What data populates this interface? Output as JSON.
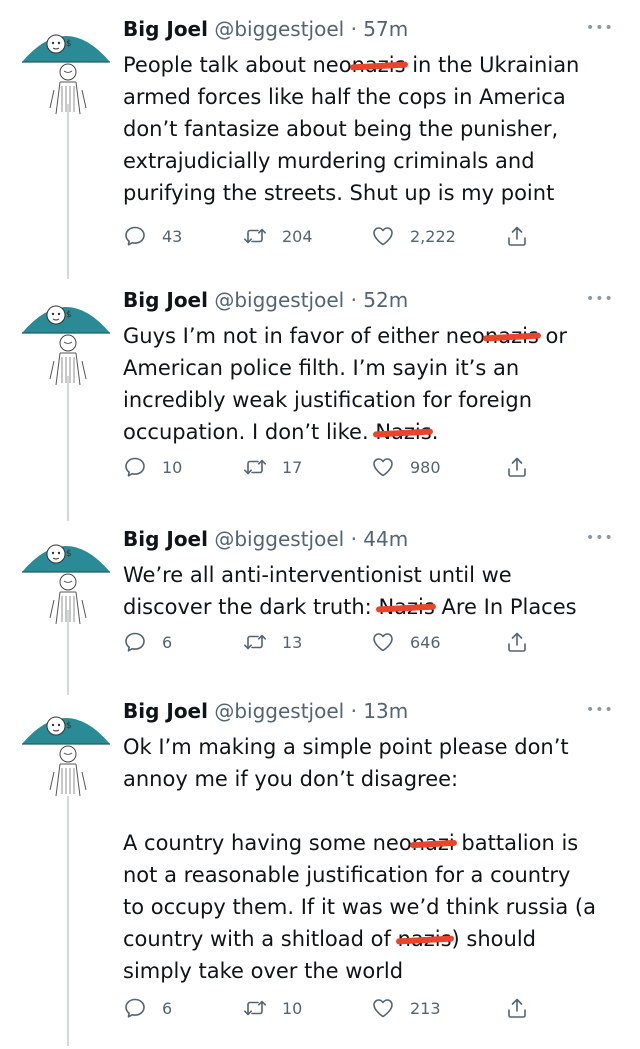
{
  "tweets": [
    {
      "name": "Big Joel",
      "handle": "@biggestjoel",
      "time": "57m",
      "lines": [
        [
          {
            "t": "People talk about neo"
          },
          {
            "t": "nazis",
            "r": true
          },
          {
            "t": " in the Ukrainian"
          }
        ],
        [
          {
            "t": "armed forces like half the cops in America"
          }
        ],
        [
          {
            "t": "don’t fantasize about being the punisher,"
          }
        ],
        [
          {
            "t": "extrajudicially murdering criminals and"
          }
        ],
        [
          {
            "t": "purifying the streets. Shut up is my point"
          }
        ]
      ],
      "replies": "43",
      "retweets": "204",
      "likes": "2,222"
    },
    {
      "name": "Big Joel",
      "handle": "@biggestjoel",
      "time": "52m",
      "lines": [
        [
          {
            "t": "Guys I’m not in favor of either neo"
          },
          {
            "t": "nazis",
            "r": true
          },
          {
            "t": " or"
          }
        ],
        [
          {
            "t": "American police filth. I’m sayin it’s an"
          }
        ],
        [
          {
            "t": "incredibly weak justification for foreign"
          }
        ],
        [
          {
            "t": "occupation. I don’t like. "
          },
          {
            "t": "Nazis",
            "r": true
          },
          {
            "t": "."
          }
        ]
      ],
      "replies": "10",
      "retweets": "17",
      "likes": "980"
    },
    {
      "name": "Big Joel",
      "handle": "@biggestjoel",
      "time": "44m",
      "lines": [
        [
          {
            "t": "We’re all anti-interventionist until we"
          }
        ],
        [
          {
            "t": "discover the dark truth: "
          },
          {
            "t": "Nazis",
            "r": true
          },
          {
            "t": " Are In Places"
          }
        ]
      ],
      "replies": "6",
      "retweets": "13",
      "likes": "646"
    },
    {
      "name": "Big Joel",
      "handle": "@biggestjoel",
      "time": "13m",
      "lines": [
        [
          {
            "t": "Ok I’m making a simple point please don’t"
          }
        ],
        [
          {
            "t": "annoy me if you don’t disagree:"
          }
        ],
        [
          {
            "t": "A country having some neo"
          },
          {
            "t": "nazi",
            "r": true
          },
          {
            "t": " battalion is"
          }
        ],
        [
          {
            "t": "not a reasonable justification for a country"
          }
        ],
        [
          {
            "t": "to occupy them. If it was we’d think russia (a"
          }
        ],
        [
          {
            "t": "country with a shitload of "
          },
          {
            "t": "nazis",
            "r": true
          },
          {
            "t": ") should"
          }
        ],
        [
          {
            "t": "simply take over the world"
          }
        ]
      ],
      "replies": "6",
      "retweets": "10",
      "likes": "213"
    }
  ],
  "ui": {
    "separator": "·",
    "more_label": "•••"
  },
  "icons": {
    "reply": "reply-icon",
    "retweet": "retweet-icon",
    "like": "like-icon",
    "share": "share-icon",
    "more": "more-icon"
  },
  "colors": {
    "text": "#0f1419",
    "secondary": "#536471",
    "avatar_teal": "#2a8a96",
    "redaction": "#e8452c",
    "thread_line": "#cfd9de"
  }
}
